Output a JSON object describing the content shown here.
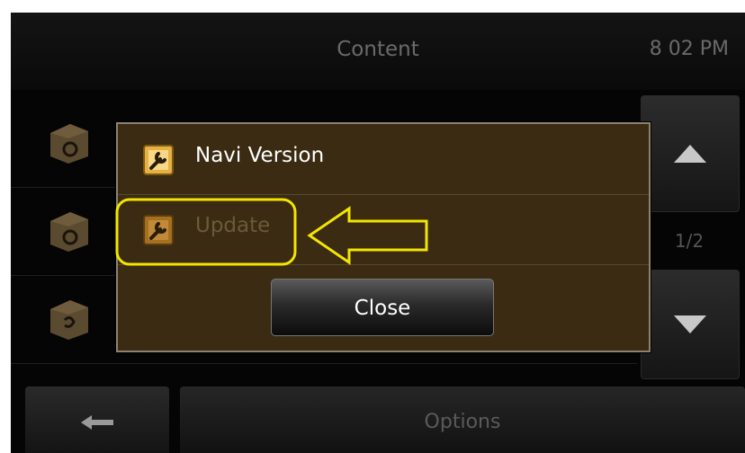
{
  "header": {
    "title": "Content",
    "time": "8 02 PM"
  },
  "background_list": {
    "items": [
      "list-item-1",
      "list-item-2",
      "list-item-3"
    ]
  },
  "scroll": {
    "page_indicator": "1/2"
  },
  "bottom_bar": {
    "options_label": "Options"
  },
  "dialog": {
    "items": [
      {
        "label": "Navi Version",
        "enabled": true
      },
      {
        "label": "Update",
        "enabled": false
      }
    ],
    "close_label": "Close"
  },
  "colors": {
    "highlight": "#f2e600",
    "dialog_bg": "#3a2b12",
    "enabled_text": "#ffffff",
    "disabled_text": "#6b5a3a"
  },
  "icons": {
    "list_item": "box-icon",
    "menu_item": "wrench-icon",
    "scroll_up": "triangle-up-icon",
    "scroll_down": "triangle-down-icon",
    "back": "arrow-left-icon",
    "annotation": "arrow-left-outline-icon"
  }
}
